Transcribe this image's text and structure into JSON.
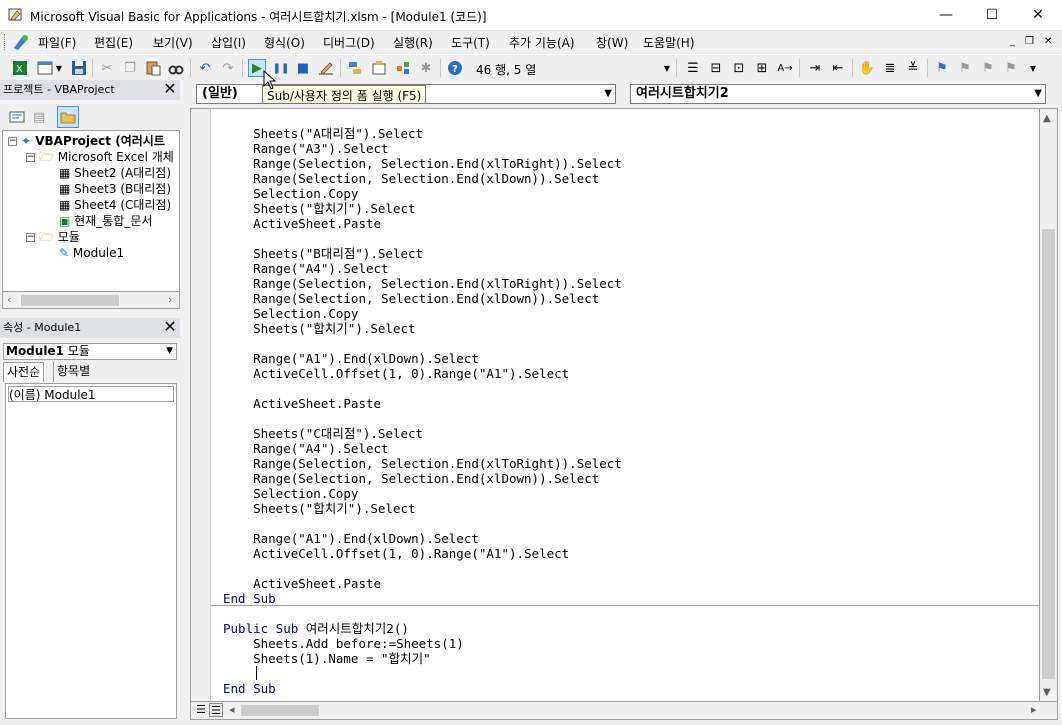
{
  "window": {
    "title": "Microsoft Visual Basic for Applications - 여러시트합치기.xlsm - [Module1 (코드)]",
    "minimize_glyph": "—",
    "maximize_glyph": "☐",
    "close_glyph": "✕"
  },
  "menu": {
    "items": [
      "파일(F)",
      "편집(E)",
      "보기(V)",
      "삽입(I)",
      "형식(O)",
      "디버그(D)",
      "실행(R)",
      "도구(T)",
      "추가 기능(A)",
      "창(W)",
      "도움말(H)"
    ],
    "mdi_min": "_",
    "mdi_restore": "❐",
    "mdi_close": "✕"
  },
  "toolbar": {
    "cursor_position": "46 행, 5 열",
    "tooltip": "Sub/사용자 정의 폼 실행 (F5)"
  },
  "project_panel": {
    "title": "프로젝트 - VBAProject",
    "close_glyph": "✕",
    "tree": {
      "root": "VBAProject (여러시트",
      "excel_objects": "Microsoft Excel 개체",
      "sheet2": "Sheet2 (A대리점)",
      "sheet3": "Sheet3 (B대리점)",
      "sheet4": "Sheet4 (C대리점)",
      "workbook": "현재_통합_문서",
      "modules": "모듈",
      "module1": "Module1"
    }
  },
  "properties_panel": {
    "title": "속성 - Module1",
    "close_glyph": "✕",
    "object_name": "Module1",
    "object_type": "모듈",
    "tab_alpha": "사전순",
    "tab_category": "항목별",
    "row_name": "(이름)",
    "row_value": "Module1"
  },
  "code_window": {
    "object_combo": "(일반)",
    "procedure_combo": "여러시트합치기2",
    "lines": [
      "    Sheets(\"A대리점\").Select",
      "    Range(\"A3\").Select",
      "    Range(Selection, Selection.End(xlToRight)).Select",
      "    Range(Selection, Selection.End(xlDown)).Select",
      "    Selection.Copy",
      "    Sheets(\"합치기\").Select",
      "    ActiveSheet.Paste",
      "",
      "    Sheets(\"B대리점\").Select",
      "    Range(\"A4\").Select",
      "    Range(Selection, Selection.End(xlToRight)).Select",
      "    Range(Selection, Selection.End(xlDown)).Select",
      "    Selection.Copy",
      "    Sheets(\"합치기\").Select",
      "",
      "    Range(\"A1\").End(xlDown).Select",
      "    ActiveCell.Offset(1, 0).Range(\"A1\").Select",
      "",
      "    ActiveSheet.Paste",
      "",
      "    Sheets(\"C대리점\").Select",
      "    Range(\"A4\").Select",
      "    Range(Selection, Selection.End(xlToRight)).Select",
      "    Range(Selection, Selection.End(xlDown)).Select",
      "    Selection.Copy",
      "    Sheets(\"합치기\").Select",
      "",
      "    Range(\"A1\").End(xlDown).Select",
      "    ActiveCell.Offset(1, 0).Range(\"A1\").Select",
      "",
      "    ActiveSheet.Paste"
    ],
    "end_sub_1": "End Sub",
    "proc2_keyword": "Public Sub",
    "proc2_name": " 여러시트합치기2()",
    "proc2_line1": "    Sheets.Add before:=Sheets(1)",
    "proc2_line2": "    Sheets(1).Name = \"합치기\"",
    "end_sub_2": "End Sub"
  },
  "colors": {
    "keyword": "#00008b",
    "panel_title_bg": "#dde0e4",
    "tooltip_bg": "#ffffe1"
  }
}
